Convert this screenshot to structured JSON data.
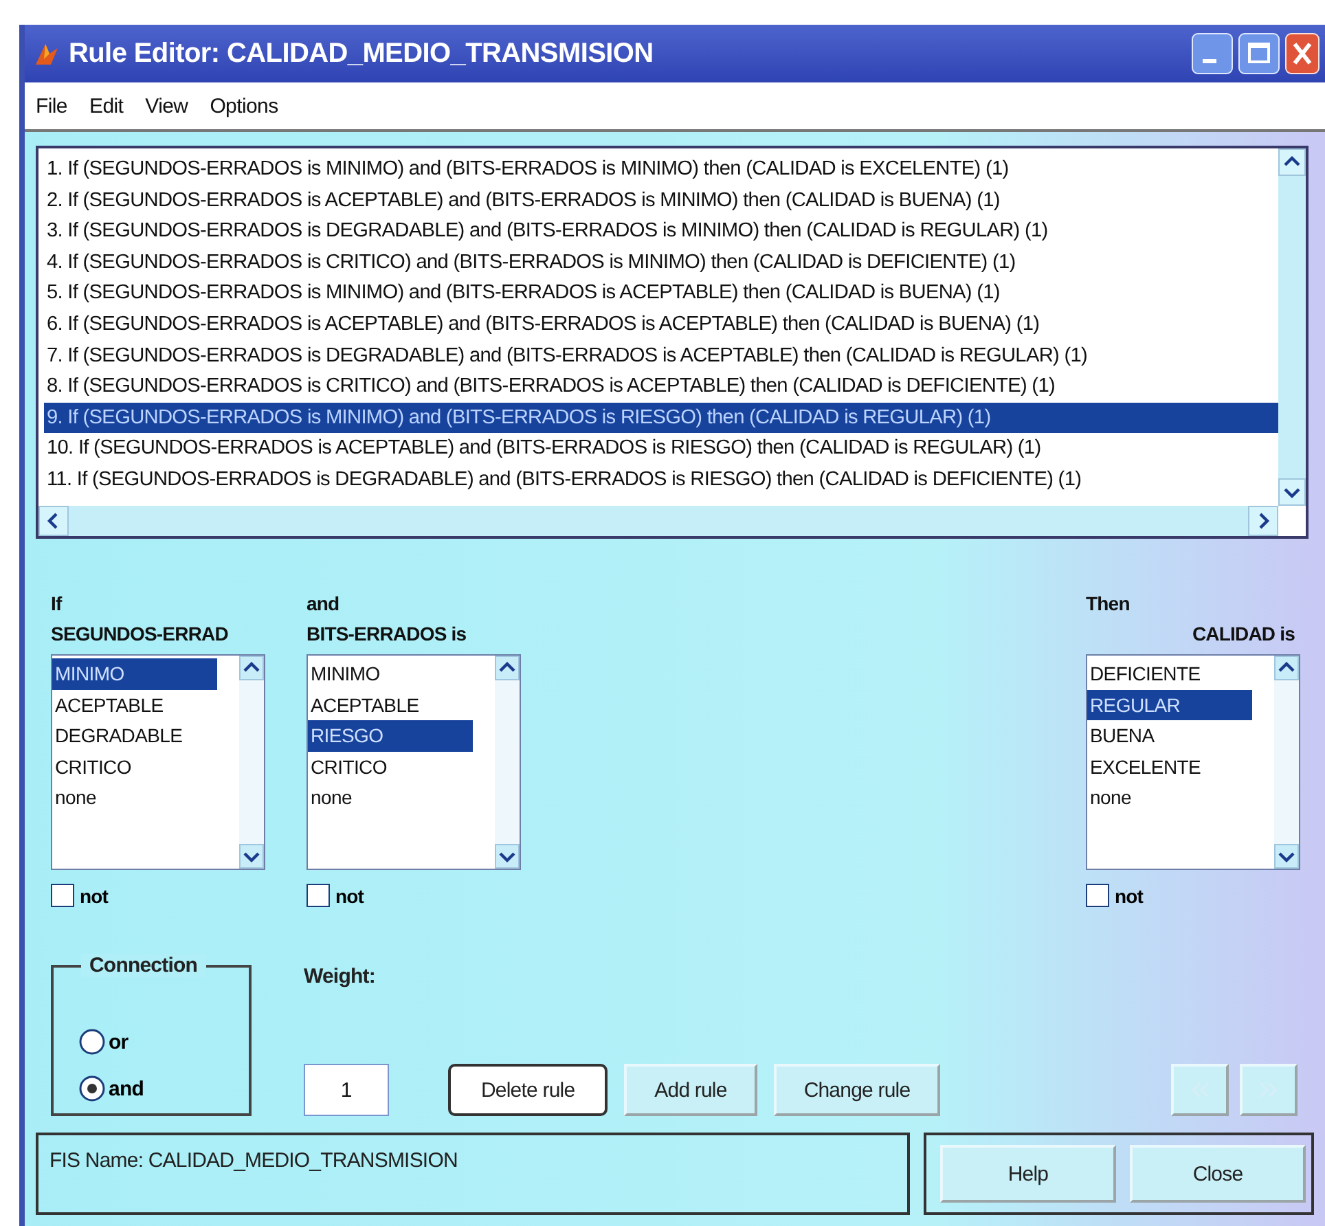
{
  "window": {
    "title": "Rule Editor: CALIDAD_MEDIO_TRANSMISION"
  },
  "menu": [
    "File",
    "Edit",
    "View",
    "Options"
  ],
  "rules": [
    {
      "text": "1. If (SEGUNDOS-ERRADOS is MINIMO) and (BITS-ERRADOS is MINIMO) then (CALIDAD is EXCELENTE) (1)",
      "selected": false
    },
    {
      "text": "2. If (SEGUNDOS-ERRADOS is ACEPTABLE) and (BITS-ERRADOS is MINIMO) then (CALIDAD is BUENA) (1)",
      "selected": false
    },
    {
      "text": "3. If (SEGUNDOS-ERRADOS is DEGRADABLE) and (BITS-ERRADOS is MINIMO) then (CALIDAD is REGULAR) (1)",
      "selected": false
    },
    {
      "text": "4. If (SEGUNDOS-ERRADOS is CRITICO) and (BITS-ERRADOS is MINIMO) then (CALIDAD is DEFICIENTE) (1)",
      "selected": false
    },
    {
      "text": "5. If (SEGUNDOS-ERRADOS is MINIMO) and (BITS-ERRADOS is ACEPTABLE) then (CALIDAD is BUENA) (1)",
      "selected": false
    },
    {
      "text": "6. If (SEGUNDOS-ERRADOS is ACEPTABLE) and (BITS-ERRADOS is ACEPTABLE) then (CALIDAD is BUENA) (1)",
      "selected": false
    },
    {
      "text": "7. If (SEGUNDOS-ERRADOS is DEGRADABLE) and (BITS-ERRADOS is ACEPTABLE) then (CALIDAD is REGULAR) (1)",
      "selected": false
    },
    {
      "text": "8. If (SEGUNDOS-ERRADOS is CRITICO) and (BITS-ERRADOS is ACEPTABLE) then (CALIDAD is DEFICIENTE) (1)",
      "selected": false
    },
    {
      "text": "9. If (SEGUNDOS-ERRADOS is MINIMO) and (BITS-ERRADOS is RIESGO) then (CALIDAD is REGULAR) (1)",
      "selected": true
    },
    {
      "text": "10. If (SEGUNDOS-ERRADOS is ACEPTABLE) and (BITS-ERRADOS is RIESGO) then (CALIDAD is REGULAR) (1)",
      "selected": false
    },
    {
      "text": "11. If (SEGUNDOS-ERRADOS is DEGRADABLE) and (BITS-ERRADOS is RIESGO) then (CALIDAD is DEFICIENTE) (1)",
      "selected": false
    }
  ],
  "variables": [
    {
      "kind": "input",
      "header": "If",
      "label": "SEGUNDOS-ERRAD",
      "not": {
        "label": "not",
        "checked": false
      },
      "options": [
        {
          "label": "MINIMO",
          "selected": true
        },
        {
          "label": "ACEPTABLE",
          "selected": false
        },
        {
          "label": "DEGRADABLE",
          "selected": false
        },
        {
          "label": "CRITICO",
          "selected": false
        },
        {
          "label": "none",
          "selected": false
        }
      ]
    },
    {
      "kind": "input",
      "header": "and",
      "label": "BITS-ERRADOS is",
      "not": {
        "label": "not",
        "checked": false
      },
      "options": [
        {
          "label": "MINIMO",
          "selected": false
        },
        {
          "label": "ACEPTABLE",
          "selected": false
        },
        {
          "label": "RIESGO",
          "selected": true
        },
        {
          "label": "CRITICO",
          "selected": false
        },
        {
          "label": "none",
          "selected": false
        }
      ]
    },
    {
      "kind": "output",
      "header": "Then",
      "label": "CALIDAD is",
      "not": {
        "label": "not",
        "checked": false
      },
      "options": [
        {
          "label": "DEFICIENTE",
          "selected": false
        },
        {
          "label": "REGULAR",
          "selected": true
        },
        {
          "label": "BUENA",
          "selected": false
        },
        {
          "label": "EXCELENTE",
          "selected": false
        },
        {
          "label": "none",
          "selected": false
        }
      ]
    }
  ],
  "connection": {
    "title": "Connection",
    "options": [
      {
        "label": "or",
        "selected": false
      },
      {
        "label": "and",
        "selected": true
      }
    ]
  },
  "weight": {
    "label": "Weight:",
    "value": "1"
  },
  "buttons": [
    {
      "label": "Delete rule",
      "focused": true
    },
    {
      "label": "Add rule",
      "focused": false
    },
    {
      "label": "Change rule",
      "focused": false
    }
  ],
  "fis_name": "FIS Name: CALIDAD_MEDIO_TRANSMISION",
  "footer_buttons": [
    "Help",
    "Close"
  ]
}
